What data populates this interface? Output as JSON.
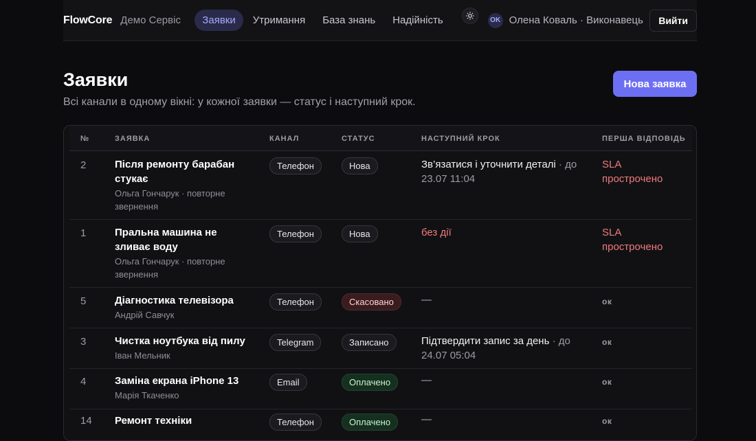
{
  "header": {
    "brand": "FlowCore",
    "org": "Демо Сервіс",
    "nav": [
      {
        "label": "Заявки",
        "active": true
      },
      {
        "label": "Утримання"
      },
      {
        "label": "База знань"
      },
      {
        "label": "Надійність"
      }
    ],
    "theme_icon": "sun-icon",
    "avatar_initials": "OK",
    "user": "Олена Коваль · Виконавець",
    "logout_label": "Вийти"
  },
  "page": {
    "title": "Заявки",
    "subtitle": "Всі канали в одному вікні: у кожної заявки — статус і наступний крок.",
    "new_button": "Нова заявка"
  },
  "table": {
    "columns": [
      "№",
      "ЗАЯВКА",
      "КАНАЛ",
      "СТАТУС",
      "НАСТУПНИЙ КРОК",
      "ПЕРША ВІДПОВІДЬ"
    ],
    "rows": [
      {
        "num": "2",
        "title": "Після ремонту барабан стукає",
        "meta": "Ольга Гончарук · повторне звернення",
        "channel": "Телефон",
        "status": "Нова",
        "step": "Зв’язатися і уточнити деталі",
        "due": " · до 23.07 11:04",
        "first_response": "SLA прострочено"
      },
      {
        "num": "1",
        "title": "Пральна машина не зливає воду",
        "meta": "Ольга Гончарук · повторне звернення",
        "channel": "Телефон",
        "status": "Нова",
        "step": "без дії",
        "due": "",
        "first_response": "SLA прострочено"
      },
      {
        "num": "5",
        "title": "Діагностика телевізора",
        "meta": "Андрій Савчук",
        "channel": "Телефон",
        "status": "Скасовано",
        "step": "—",
        "due": "",
        "first_response": "ок"
      },
      {
        "num": "3",
        "title": "Чистка ноутбука від пилу",
        "meta": "Іван Мельник",
        "channel": "Telegram",
        "status": "Записано",
        "step": "Підтвердити запис за день",
        "due": " · до 24.07 05:04",
        "first_response": "ок"
      },
      {
        "num": "4",
        "title": "Заміна екрана iPhone 13",
        "meta": "Марія Ткаченко",
        "channel": "Email",
        "status": "Оплачено",
        "step": "—",
        "due": "",
        "first_response": "ок"
      },
      {
        "num": "14",
        "title": "Ремонт техніки",
        "meta": "",
        "channel": "Телефон",
        "status": "Оплачено",
        "step": "—",
        "due": "",
        "first_response": "ок"
      }
    ]
  }
}
